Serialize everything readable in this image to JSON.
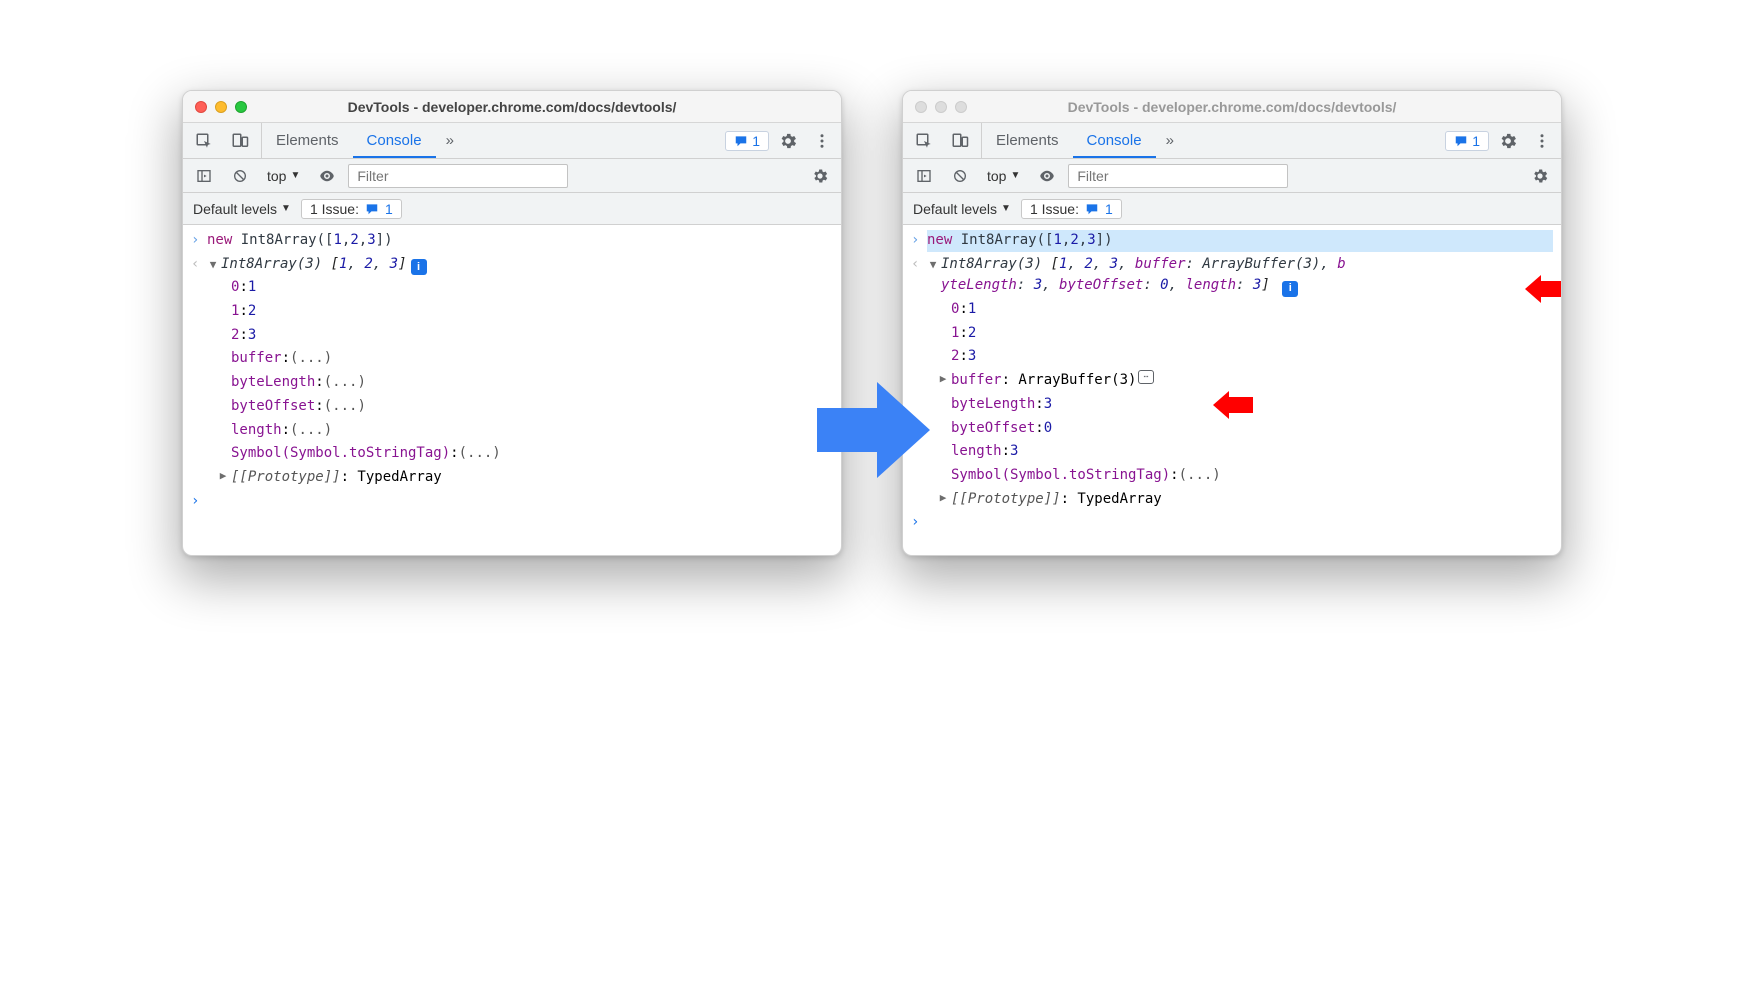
{
  "windows": {
    "title": "DevTools - developer.chrome.com/docs/devtools/",
    "tabs": {
      "elements": "Elements",
      "console": "Console"
    },
    "issue_chip": "1",
    "toolbar2": {
      "context": "top",
      "filter_placeholder": "Filter"
    },
    "toolbar3": {
      "levels": "Default levels",
      "issues_label": "1 Issue:",
      "issues_count": "1"
    }
  },
  "left": {
    "input": "new Int8Array([1,2,3])",
    "summary": {
      "name": "Int8Array(3)",
      "vals": "[1, 2, 3]"
    },
    "rows": [
      {
        "k": "0",
        "v": "1"
      },
      {
        "k": "1",
        "v": "2"
      },
      {
        "k": "2",
        "v": "3"
      }
    ],
    "lazy": [
      "buffer",
      "byteLength",
      "byteOffset",
      "length",
      "Symbol(Symbol.toStringTag)"
    ],
    "proto": {
      "label": "[[Prototype]]",
      "v": "TypedArray"
    }
  },
  "right": {
    "input": "new Int8Array([1,2,3])",
    "summary_line1": "Int8Array(3) [1, 2, 3, buffer: ArrayBuffer(3), b",
    "summary_line2": "yteLength: 3, byteOffset: 0, length: 3]",
    "rows": [
      {
        "k": "0",
        "v": "1"
      },
      {
        "k": "1",
        "v": "2"
      },
      {
        "k": "2",
        "v": "3"
      }
    ],
    "buffer": {
      "k": "buffer",
      "v": "ArrayBuffer(3)"
    },
    "evaluated": [
      {
        "k": "byteLength",
        "v": "3"
      },
      {
        "k": "byteOffset",
        "v": "0"
      },
      {
        "k": "length",
        "v": "3"
      }
    ],
    "symbol": {
      "k": "Symbol(Symbol.toStringTag)",
      "v": "(...)"
    },
    "proto": {
      "label": "[[Prototype]]",
      "v": "TypedArray"
    }
  }
}
